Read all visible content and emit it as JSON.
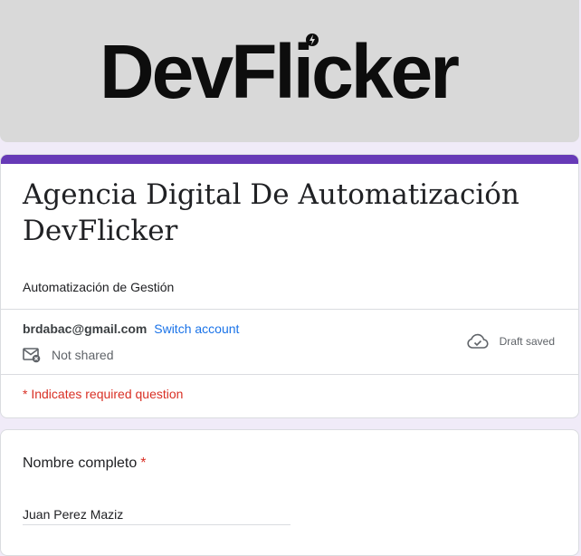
{
  "banner": {
    "logo_text": "DevFlicker"
  },
  "form": {
    "title": "Agencia Digital De Automatización DevFlicker",
    "description": "Automatización de Gestión",
    "account_email": "brdabac@gmail.com",
    "switch_account_label": "Switch account",
    "not_shared_label": "Not shared",
    "draft_status": "Draft saved",
    "required_note": "* Indicates required question"
  },
  "question": {
    "label": "Nombre completo",
    "required_marker": "*",
    "answer_value": "Juan Perez Maziz"
  },
  "colors": {
    "accent": "#673ab7",
    "page_background": "#f0ebf8",
    "link": "#1a73e8",
    "required": "#d93025",
    "banner_background": "#d9d9d9"
  },
  "icons": [
    "lightning-icon",
    "mail-not-shared-icon",
    "cloud-check-icon"
  ]
}
